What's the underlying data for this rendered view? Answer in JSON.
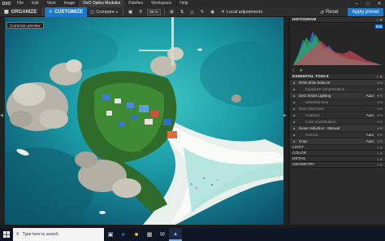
{
  "app": {
    "logo": "DXO"
  },
  "menu": [
    "File",
    "Edit",
    "View",
    "Image",
    "DxO Optics Modules",
    "Palettes",
    "Workspace",
    "Help"
  ],
  "menu_active_index": 4,
  "toolbar": {
    "organize_label": "ORGANIZE",
    "customize_label": "CUSTOMIZE",
    "compare_label": "Compare",
    "zoom_value": "35 %",
    "local_adjustments_label": "Local adjustments",
    "reset_label": "Reset",
    "apply_preset_label": "Apply preset"
  },
  "viewer": {
    "correction_preview_label": "Correction preview"
  },
  "panel": {
    "histogram_label": "HISTOGRAM",
    "histogram_channel": "RGB",
    "essential_tools_label": "ESSENTIAL TOOLS",
    "tools": [
      {
        "label": "RGB white balance",
        "value": "",
        "state": "on",
        "sub": false
      },
      {
        "label": "Exposure compensation",
        "value": "",
        "state": "off",
        "sub": true
      },
      {
        "label": "DxO Smart Lighting",
        "value": "Auto",
        "state": "on",
        "sub": false
      },
      {
        "label": "Selective tone",
        "value": "",
        "state": "off",
        "sub": true
      },
      {
        "label": "DxO ClearView",
        "value": "",
        "state": "off",
        "sub": false
      },
      {
        "label": "Contrast",
        "value": "Auto",
        "state": "off",
        "sub": true
      },
      {
        "label": "Color accentuation",
        "value": "",
        "state": "off",
        "sub": true
      },
      {
        "label": "Noise reduction - Manual",
        "value": "",
        "state": "on",
        "sub": false
      },
      {
        "label": "Horizon",
        "value": "Auto",
        "state": "off",
        "sub": true
      },
      {
        "label": "Crop",
        "value": "Auto",
        "state": "on",
        "sub": false
      }
    ],
    "palettes": [
      "LIGHT",
      "COLOR",
      "DETAIL",
      "GEOMETRY"
    ]
  },
  "taskbar": {
    "search_placeholder": "Type here to search"
  },
  "colors": {
    "accent": "#1e78c8",
    "panel_bg": "#2b2b2b",
    "taskbar_bg": "#0e1525"
  }
}
